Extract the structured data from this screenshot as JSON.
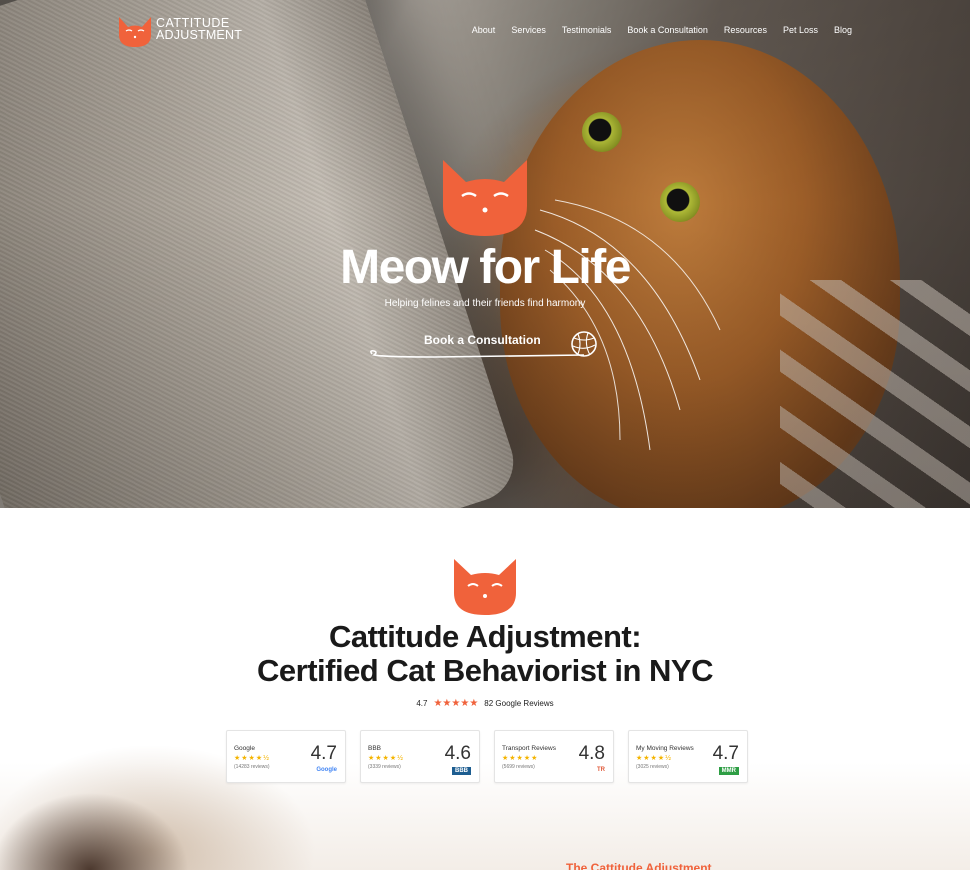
{
  "brand": {
    "line1": "CATTITUDE",
    "line2": "ADJUSTMENT",
    "accent": "#f0623b"
  },
  "nav": {
    "items": [
      {
        "label": "About"
      },
      {
        "label": "Services"
      },
      {
        "label": "Testimonials"
      },
      {
        "label": "Book a Consultation"
      },
      {
        "label": "Resources"
      },
      {
        "label": "Pet Loss"
      },
      {
        "label": "Blog"
      }
    ]
  },
  "hero": {
    "title": "Meow for Life",
    "subtitle": "Helping felines and their friends find harmony",
    "cta_label": "Book a Consultation"
  },
  "section": {
    "title_line1": "Cattitude Adjustment:",
    "title_line2": "Certified Cat Behaviorist in NYC",
    "rating_value": "4.7",
    "rating_stars": "★★★★★",
    "rating_text": "82 Google Reviews"
  },
  "review_cards": [
    {
      "name": "Google",
      "stars": "★★★★½",
      "count": "(14283 reviews)",
      "score": "4.7",
      "badge": "Google",
      "badge_color": "#4285f4"
    },
    {
      "name": "BBB",
      "stars": "★★★★½",
      "count": "(3339 reviews)",
      "score": "4.6",
      "badge": "BBB",
      "badge_color": "#1d5d90"
    },
    {
      "name": "Transport Reviews",
      "stars": "★★★★★",
      "count": "(5699 reviews)",
      "score": "4.8",
      "badge": "TR",
      "badge_color": "#e05a3a"
    },
    {
      "name": "My Moving Reviews",
      "stars": "★★★★½",
      "count": "(3025 reviews)",
      "score": "4.7",
      "badge": "MMR",
      "badge_color": "#2e9e44"
    }
  ],
  "bottom": {
    "heading": "The Cattitude Adjustment"
  }
}
